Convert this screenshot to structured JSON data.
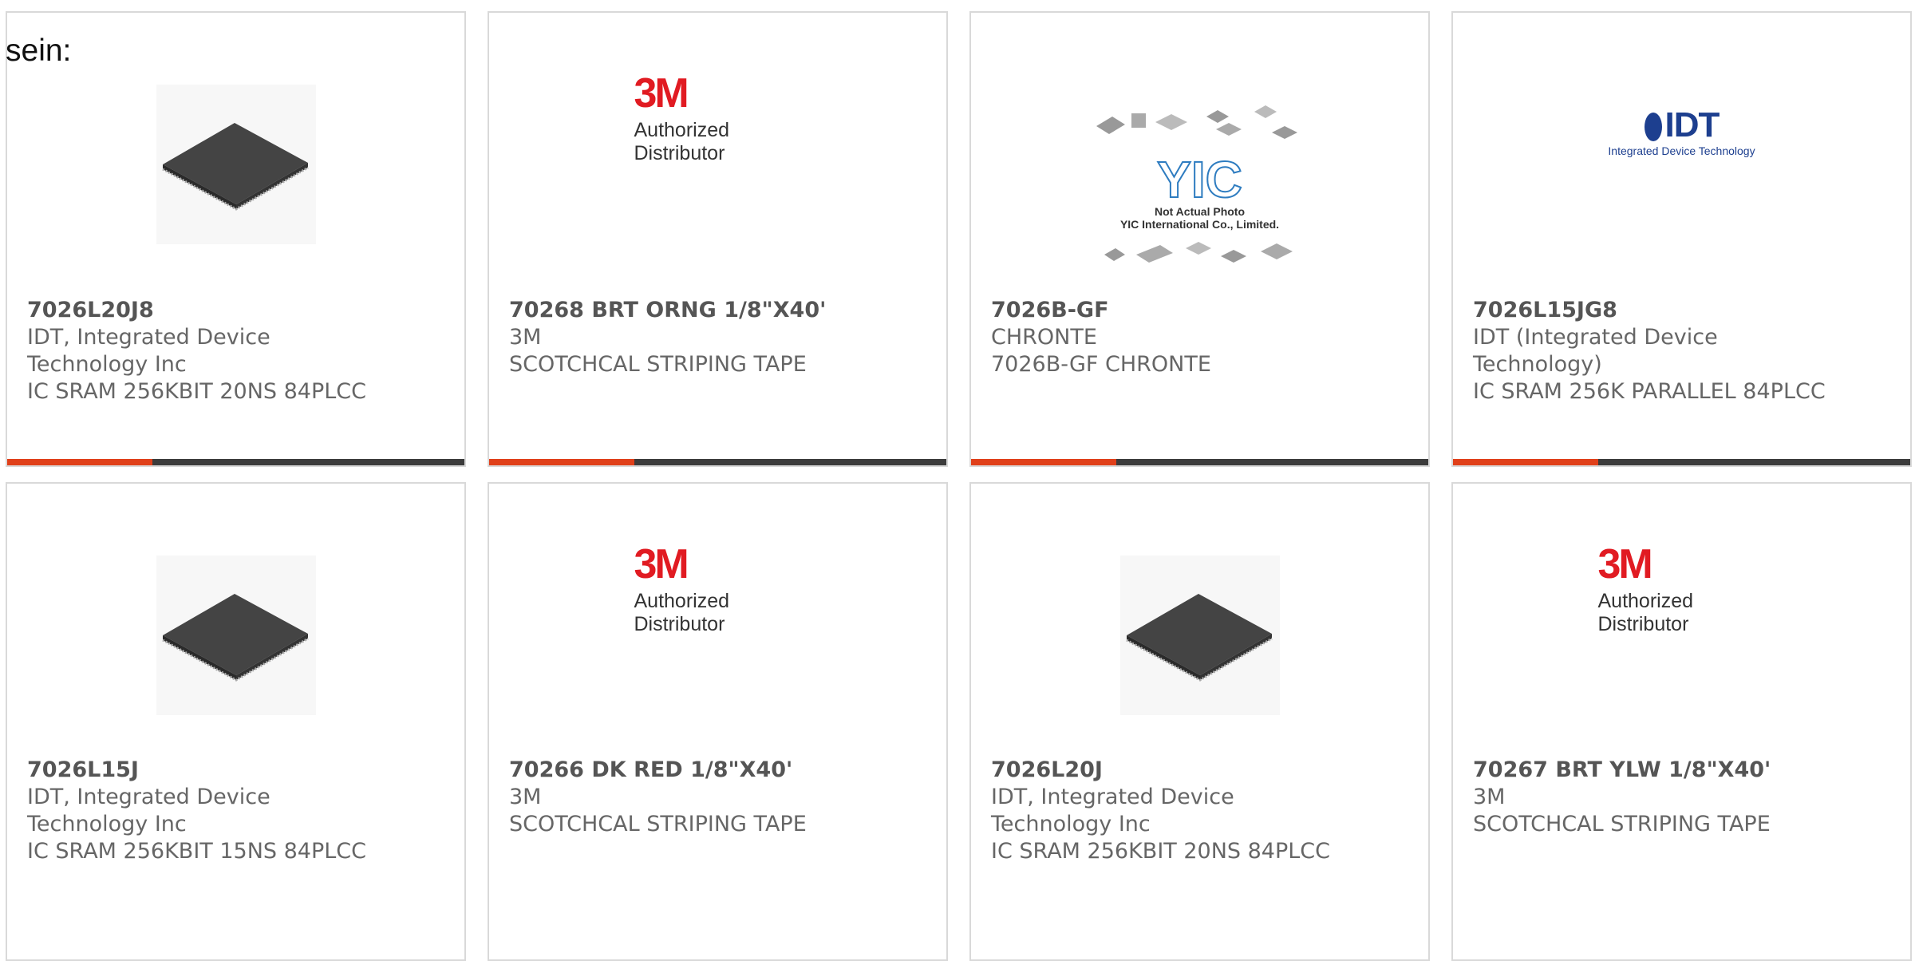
{
  "intro_text": "sein:",
  "cards": [
    {
      "part": "7026L20J8",
      "maker_lines": [
        "IDT, Integrated Device",
        "Technology Inc"
      ],
      "description": "IC SRAM 256KBIT 20NS 84PLCC",
      "image": "chip-icon"
    },
    {
      "part": "70268 BRT ORNG 1/8\"X40'",
      "maker_lines": [
        "3M"
      ],
      "description": "SCOTCHCAL STRIPING TAPE",
      "image": "3m-logo",
      "logo_text": "3M",
      "logo_caption": "Authorized Distributor"
    },
    {
      "part": "7026B-GF",
      "maker_lines": [
        "CHRONTE"
      ],
      "description": "7026B-GF CHRONTE",
      "image": "yic-placeholder",
      "logo_text": "YIC",
      "caption_1": "Not Actual Photo",
      "caption_2": "YIC International Co., Limited."
    },
    {
      "part": "7026L15JG8",
      "maker_lines": [
        "IDT (Integrated Device",
        "Technology)"
      ],
      "description": "IC SRAM 256K PARALLEL 84PLCC",
      "image": "idt-logo",
      "logo_text": "IDT",
      "logo_caption": "Integrated Device Technology"
    },
    {
      "part": "7026L15J",
      "maker_lines": [
        "IDT, Integrated Device",
        "Technology Inc"
      ],
      "description": "IC SRAM 256KBIT 15NS 84PLCC",
      "image": "chip-icon"
    },
    {
      "part": "70266 DK RED 1/8\"X40'",
      "maker_lines": [
        "3M"
      ],
      "description": "SCOTCHCAL STRIPING TAPE",
      "image": "3m-logo",
      "logo_text": "3M",
      "logo_caption": "Authorized Distributor"
    },
    {
      "part": "7026L20J",
      "maker_lines": [
        "IDT, Integrated Device",
        "Technology Inc"
      ],
      "description": "IC SRAM 256KBIT 20NS 84PLCC",
      "image": "chip-icon"
    },
    {
      "part": "70267 BRT YLW 1/8\"X40'",
      "maker_lines": [
        "3M"
      ],
      "description": "SCOTCHCAL STRIPING TAPE",
      "image": "3m-logo",
      "logo_text": "3M",
      "logo_caption": "Authorized Distributor"
    }
  ],
  "colors": {
    "accent": "#e0401a",
    "bar": "#3c3c3c",
    "border": "#d9d9d9",
    "text": "#666666"
  }
}
